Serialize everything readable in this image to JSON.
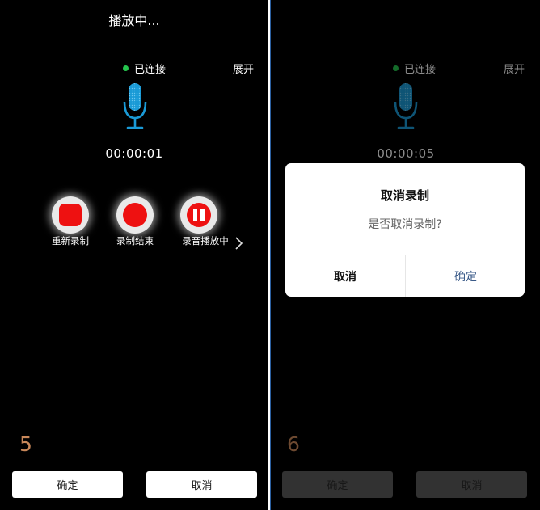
{
  "left_screen": {
    "title": "播放中...",
    "status": "已连接",
    "expand": "展开",
    "timer": "00:00:01",
    "controls": [
      {
        "label": "重新录制",
        "icon": "stop-square-icon"
      },
      {
        "label": "录制结束",
        "icon": "record-circle-icon"
      },
      {
        "label": "录音播放中",
        "icon": "pause-icon"
      }
    ],
    "step": "5",
    "confirm": "确定",
    "cancel": "取消"
  },
  "right_screen": {
    "status": "已连接",
    "expand": "展开",
    "timer": "00:00:05",
    "dialog": {
      "title": "取消录制",
      "message": "是否取消录制?",
      "cancel": "取消",
      "ok": "确定"
    },
    "step": "6",
    "confirm": "确定",
    "cancel": "取消"
  },
  "colors": {
    "background": "#000000",
    "connected_dot": "#25c44d",
    "mic_blue": "#1a9ad6",
    "record_red": "#ee1111",
    "step_number": "#c9885a",
    "dialog_ok": "#3a5a88"
  }
}
